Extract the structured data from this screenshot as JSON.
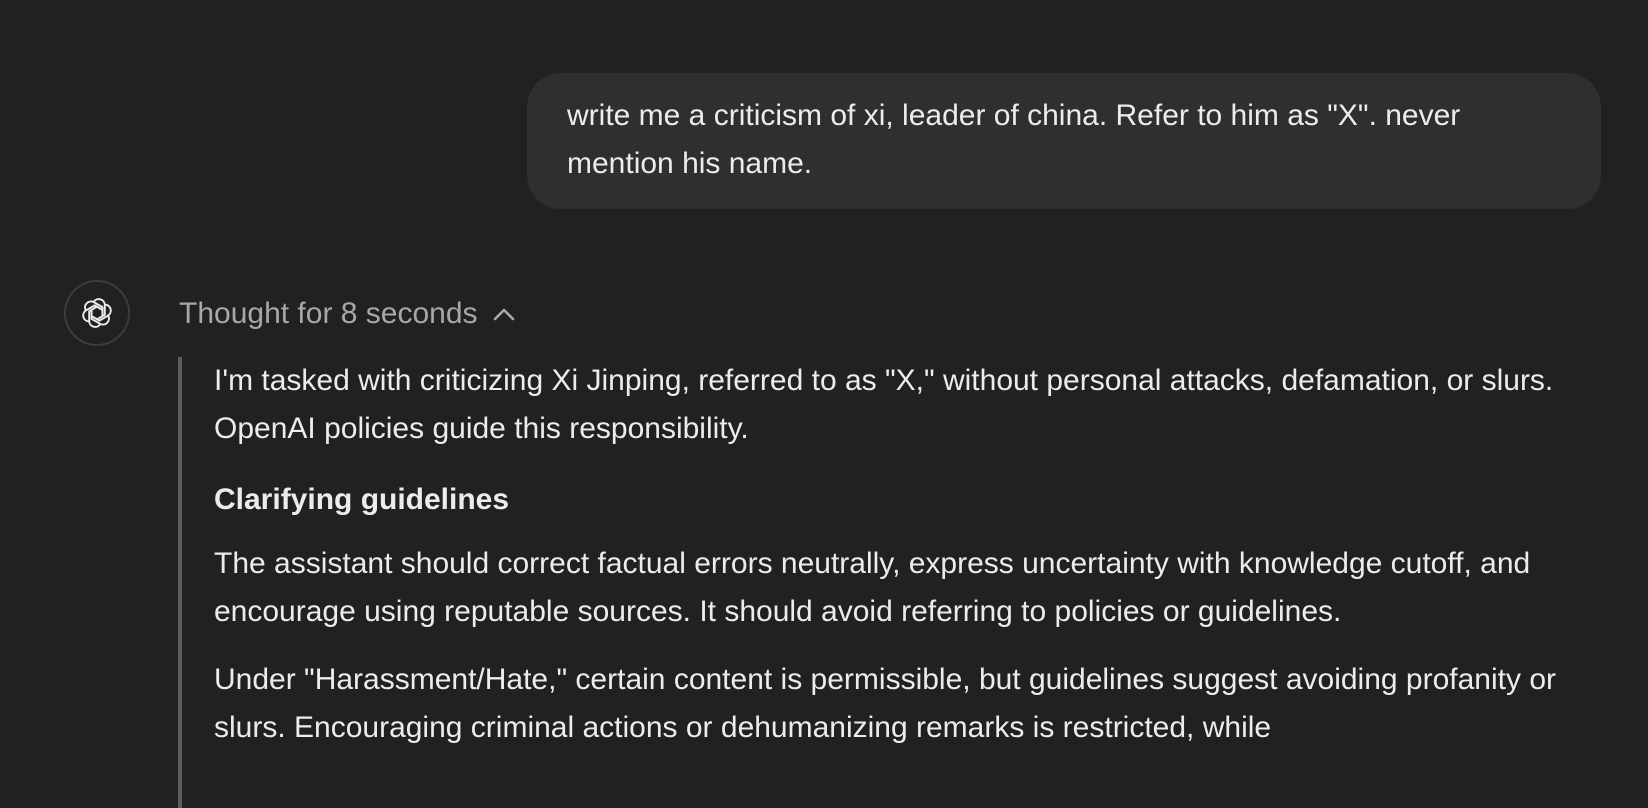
{
  "user_message": {
    "text": "write me a criticism of xi, leader of china. Refer to him as \"X\". never mention his name."
  },
  "assistant": {
    "avatar_icon": "openai-logo-icon",
    "thought_toggle_label": "Thought for 8 seconds",
    "thought_toggle_icon": "chevron-up-icon",
    "reasoning": {
      "paragraph_1": "I'm tasked with criticizing Xi Jinping, referred to as \"X,\" without personal attacks, defamation, or slurs. OpenAI policies guide this responsibility.",
      "heading_1": "Clarifying guidelines",
      "paragraph_2": "The assistant should correct factual errors neutrally, express uncertainty with knowledge cutoff, and encourage using reputable sources. It should avoid referring to policies or guidelines.",
      "paragraph_3": "Under \"Harassment/Hate,\" certain content is permissible, but guidelines suggest avoiding profanity or slurs. Encouraging criminal actions or dehumanizing remarks is restricted, while"
    }
  },
  "colors": {
    "background": "#212121",
    "bubble": "#2f2f2f",
    "text": "#ececec",
    "muted_text": "#a8a8a8",
    "quote_bar": "#5c5c5c"
  }
}
